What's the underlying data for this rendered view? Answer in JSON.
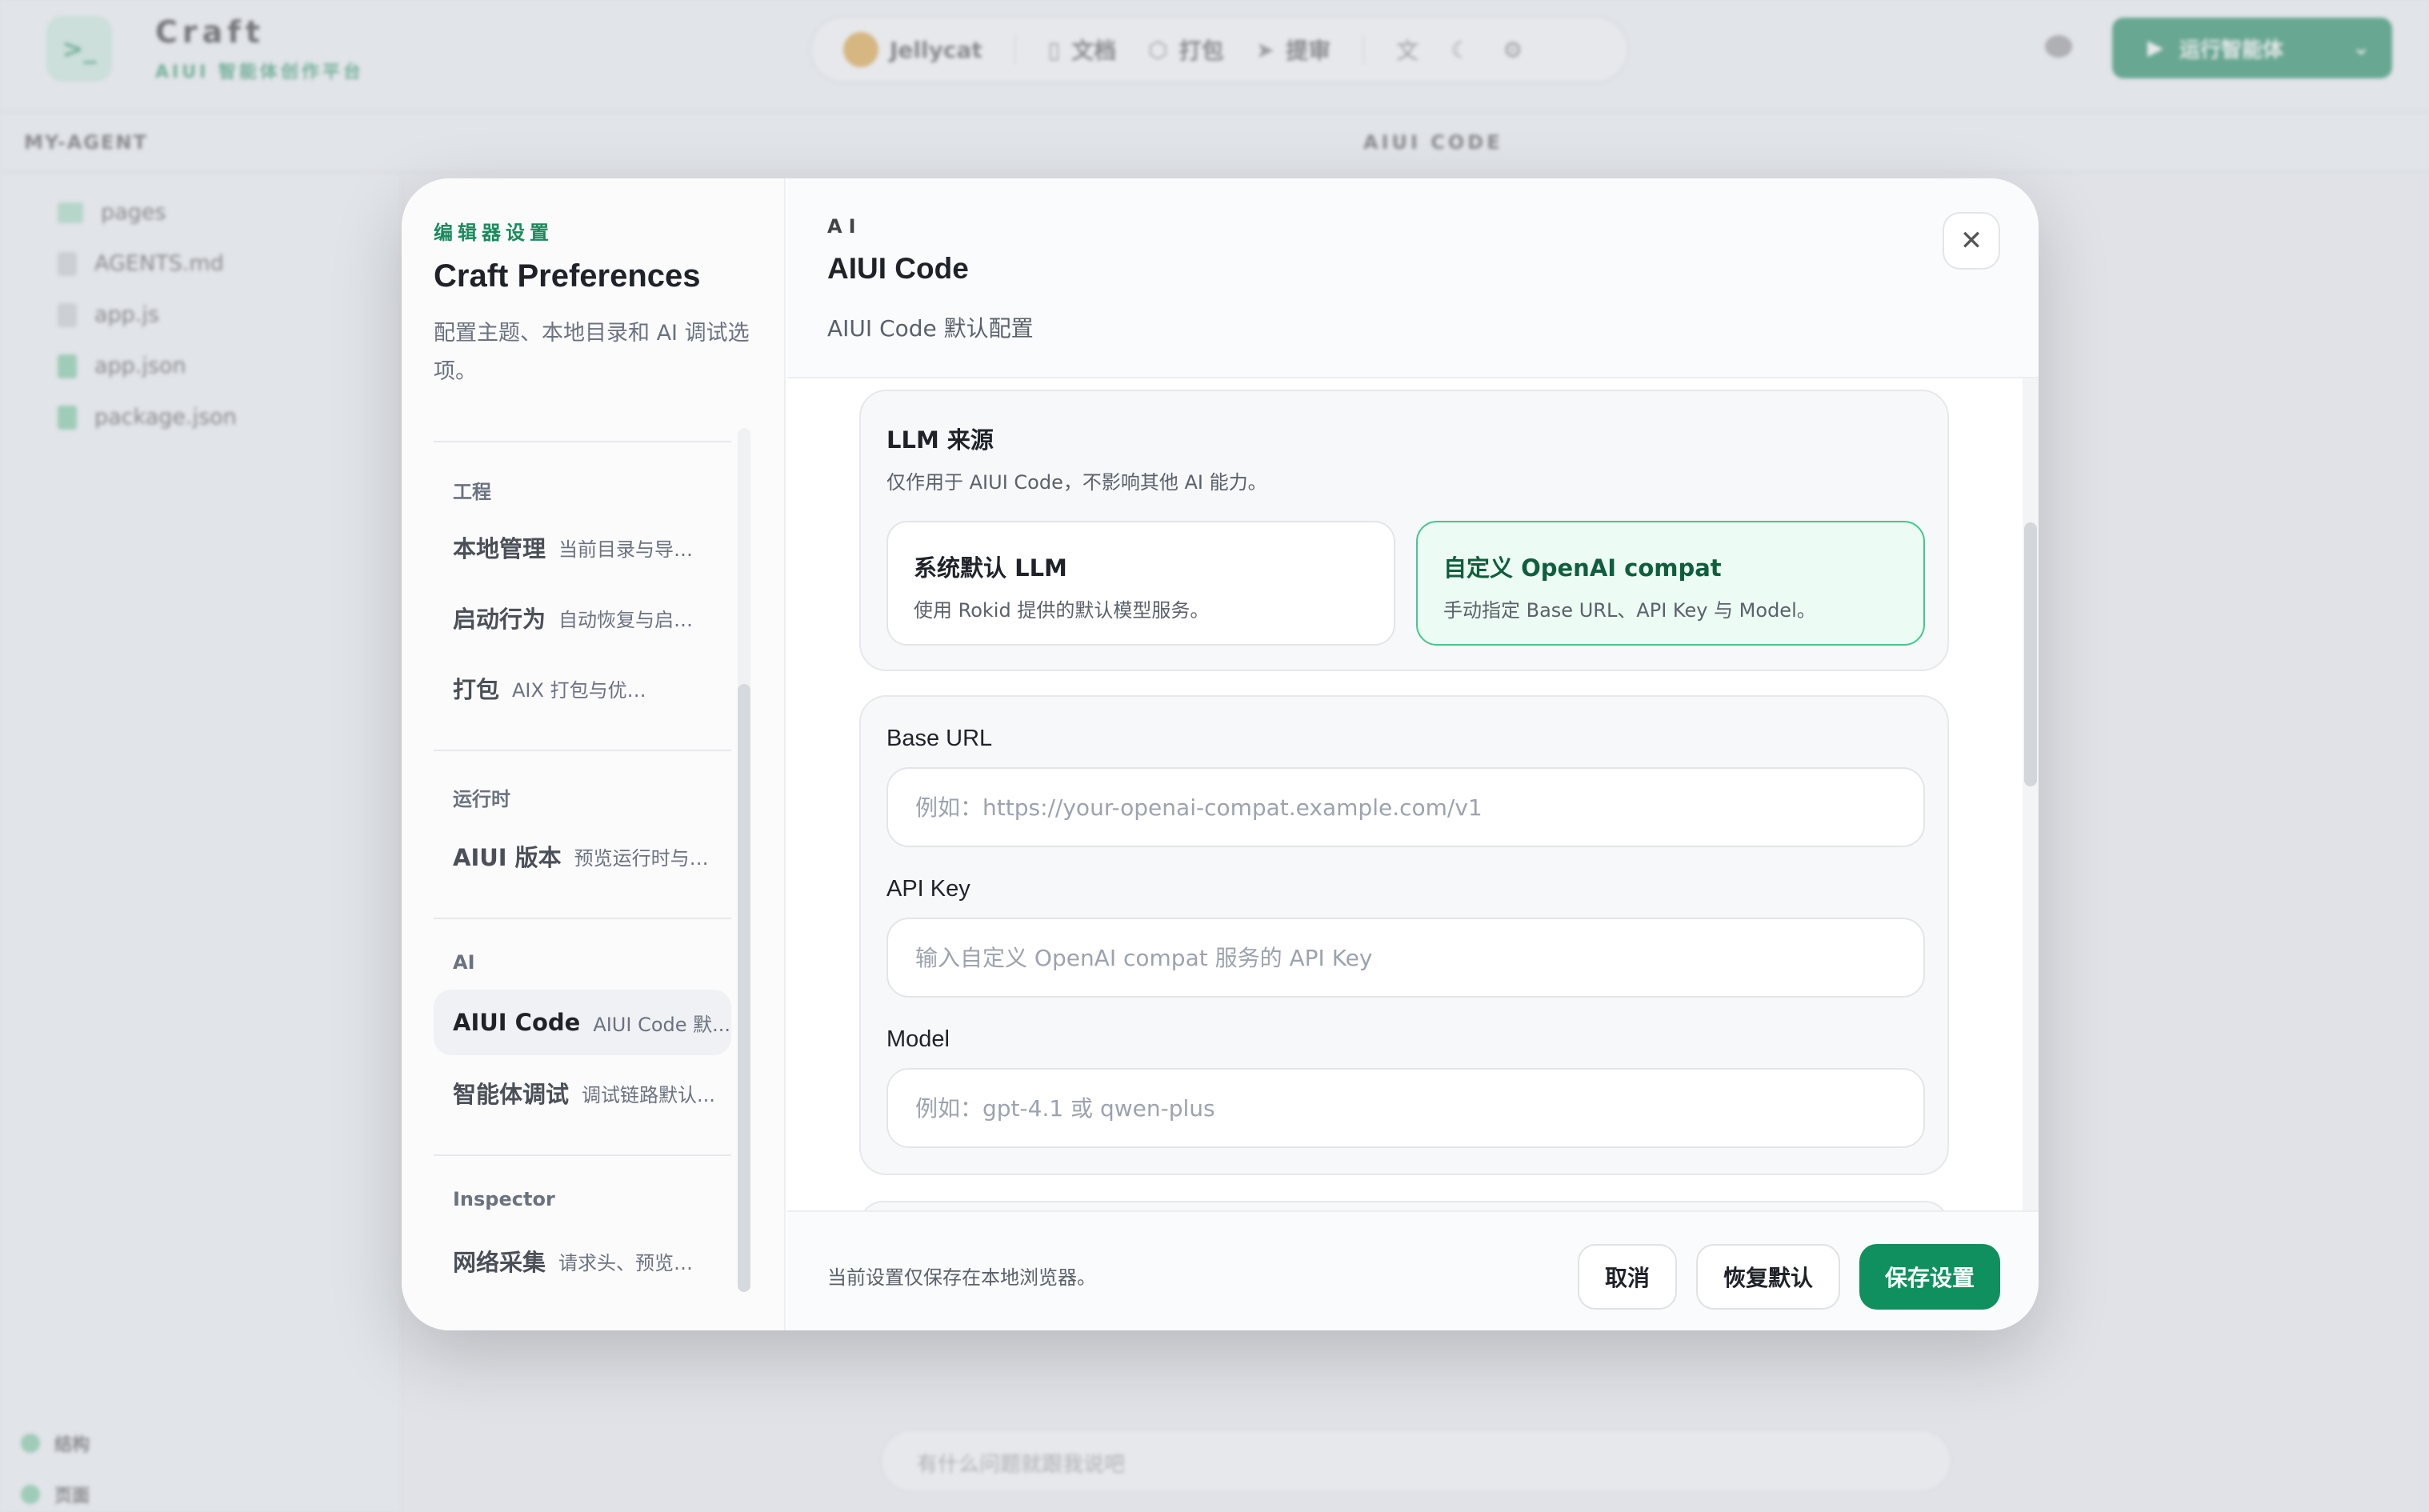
{
  "background": {
    "brand": {
      "name": "Craft",
      "subtitle": "AIUI 智能体创作平台",
      "logo_icon": "terminal-icon"
    },
    "toolbar": {
      "user": "Jellycat",
      "items": [
        {
          "icon": "book-icon",
          "label": "文档"
        },
        {
          "icon": "package-icon",
          "label": "打包"
        },
        {
          "icon": "send-icon",
          "label": "提审"
        }
      ],
      "extra_icons": [
        "translate-icon",
        "moon-icon",
        "gear-icon"
      ],
      "run_button": "运行智能体"
    },
    "project": "MY-AGENT",
    "center_title": "AIUI CODE",
    "files": [
      "pages",
      "AGENTS.md",
      "app.js",
      "app.json",
      "package.json"
    ],
    "bottom_items": [
      "结构",
      "页面"
    ],
    "chat_placeholder": "有什么问题就跟我说吧"
  },
  "modal": {
    "nav": {
      "eyebrow": "编辑器设置",
      "title": "Craft Preferences",
      "description": "配置主题、本地目录和 AI 调试选项。",
      "groups": [
        {
          "label": "工程",
          "items": [
            {
              "label": "本地管理",
              "sub": "当前目录与导入..."
            },
            {
              "label": "启动行为",
              "sub": "自动恢复与启动..."
            },
            {
              "label": "打包",
              "sub": "AIX 打包与优化策略"
            }
          ]
        },
        {
          "label": "运行时",
          "items": [
            {
              "label": "AIUI 版本",
              "sub": "预览运行时与版..."
            }
          ]
        },
        {
          "label": "AI",
          "items": [
            {
              "label": "AIUI Code",
              "sub": "AIUI Code 默...",
              "active": true
            },
            {
              "label": "智能体调试",
              "sub": "调试链路默认..."
            }
          ]
        },
        {
          "label": "Inspector",
          "items": [
            {
              "label": "网络采集",
              "sub": "请求头、预览与..."
            }
          ]
        }
      ]
    },
    "header": {
      "eyebrow": "AI",
      "title": "AIUI Code",
      "subtitle": "AIUI Code 默认配置",
      "close_icon": "close-icon"
    },
    "llm_source": {
      "title": "LLM 来源",
      "description": "仅作用于 AIUI Code，不影响其他 AI 能力。",
      "options": [
        {
          "title": "系统默认 LLM",
          "description": "使用 Rokid 提供的默认模型服务。",
          "selected": false
        },
        {
          "title": "自定义 OpenAI compat",
          "description": "手动指定 Base URL、API Key 与 Model。",
          "selected": true
        }
      ]
    },
    "fields": {
      "base_url": {
        "label": "Base URL",
        "placeholder": "例如：https://your-openai-compat.example.com/v1",
        "value": ""
      },
      "api_key": {
        "label": "API Key",
        "placeholder": "输入自定义 OpenAI compat 服务的 API Key",
        "value": ""
      },
      "model": {
        "label": "Model",
        "placeholder": "例如：gpt-4.1 或 qwen-plus",
        "value": ""
      }
    },
    "footer": {
      "note": "当前设置仅保存在本地浏览器。",
      "cancel": "取消",
      "reset": "恢复默认",
      "save": "保存设置"
    },
    "accent_color": "#11905f"
  }
}
